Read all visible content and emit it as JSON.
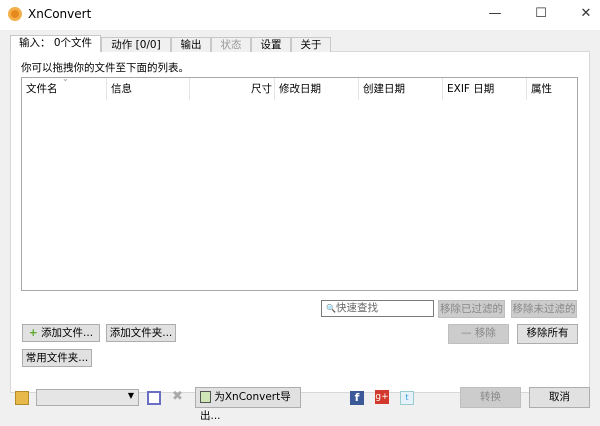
{
  "window": {
    "title": "XnConvert",
    "minimize": "—",
    "maximize": "☐",
    "close": "✕"
  },
  "tabs": [
    {
      "label": "输入： 0个文件"
    },
    {
      "label": "动作 [0/0]"
    },
    {
      "label": "输出"
    },
    {
      "label": "状态"
    },
    {
      "label": "设置"
    },
    {
      "label": "关于"
    }
  ],
  "hint": "你可以拖拽你的文件至下面的列表。",
  "columns": [
    "文件名",
    "信息",
    "尺寸",
    "修改日期",
    "创建日期",
    "EXIF 日期",
    "属性"
  ],
  "search": {
    "placeholder": "快速查找"
  },
  "buttons": {
    "remove_filtered": "移除已过滤的",
    "remove_unfiltered": "移除未过滤的",
    "add_files": "添加文件...",
    "add_folder": "添加文件夹...",
    "remove": "移除",
    "remove_all": "移除所有",
    "common_folders": "常用文件夹...",
    "export": "为XnConvert导出...",
    "convert": "转换",
    "cancel": "取消"
  },
  "icons": {
    "plus": "+",
    "minus": "—",
    "search": "🔍"
  }
}
